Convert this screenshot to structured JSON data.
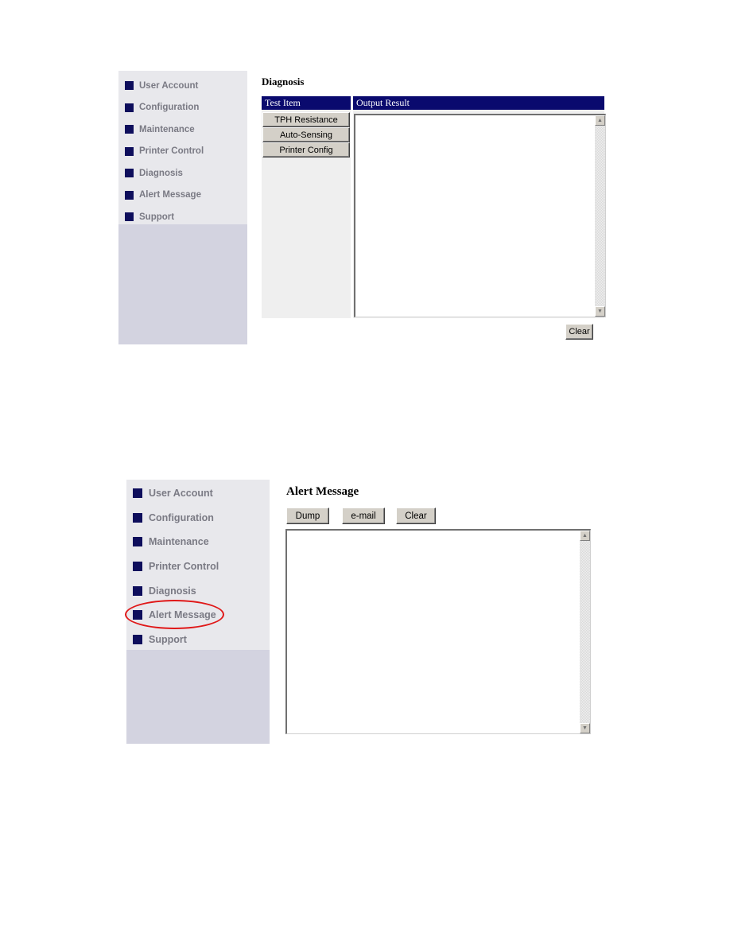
{
  "panel_diagnosis": {
    "sidebar": {
      "items": [
        {
          "label": "User Account"
        },
        {
          "label": "Configuration"
        },
        {
          "label": "Maintenance"
        },
        {
          "label": "Printer Control"
        },
        {
          "label": "Diagnosis"
        },
        {
          "label": "Alert Message"
        },
        {
          "label": "Support"
        }
      ]
    },
    "title": "Diagnosis",
    "test_item_header": "Test Item",
    "output_result_header": "Output Result",
    "test_buttons": [
      {
        "label": "TPH Resistance"
      },
      {
        "label": "Auto-Sensing"
      },
      {
        "label": "Printer Config"
      }
    ],
    "output_text": "",
    "clear_label": "Clear"
  },
  "panel_alert": {
    "sidebar": {
      "items": [
        {
          "label": "User Account"
        },
        {
          "label": "Configuration"
        },
        {
          "label": "Maintenance"
        },
        {
          "label": "Printer Control"
        },
        {
          "label": "Diagnosis"
        },
        {
          "label": "Alert Message",
          "highlighted": true
        },
        {
          "label": "Support"
        }
      ]
    },
    "title": "Alert Message",
    "buttons": {
      "dump": "Dump",
      "email": "e-mail",
      "clear": "Clear"
    },
    "message_text": ""
  },
  "colors": {
    "header_bg": "#0a0a6e",
    "nav_square": "#0e0e5c",
    "nav_text": "#7a7a84",
    "sidebar_bg": "#e8e8ec",
    "sidebar_filler": "#d3d3e0",
    "highlight_ring": "#e01818"
  },
  "icons": {
    "nav_bullet": "square-bullet-icon",
    "scroll_up": "▲",
    "scroll_down": "▼"
  }
}
